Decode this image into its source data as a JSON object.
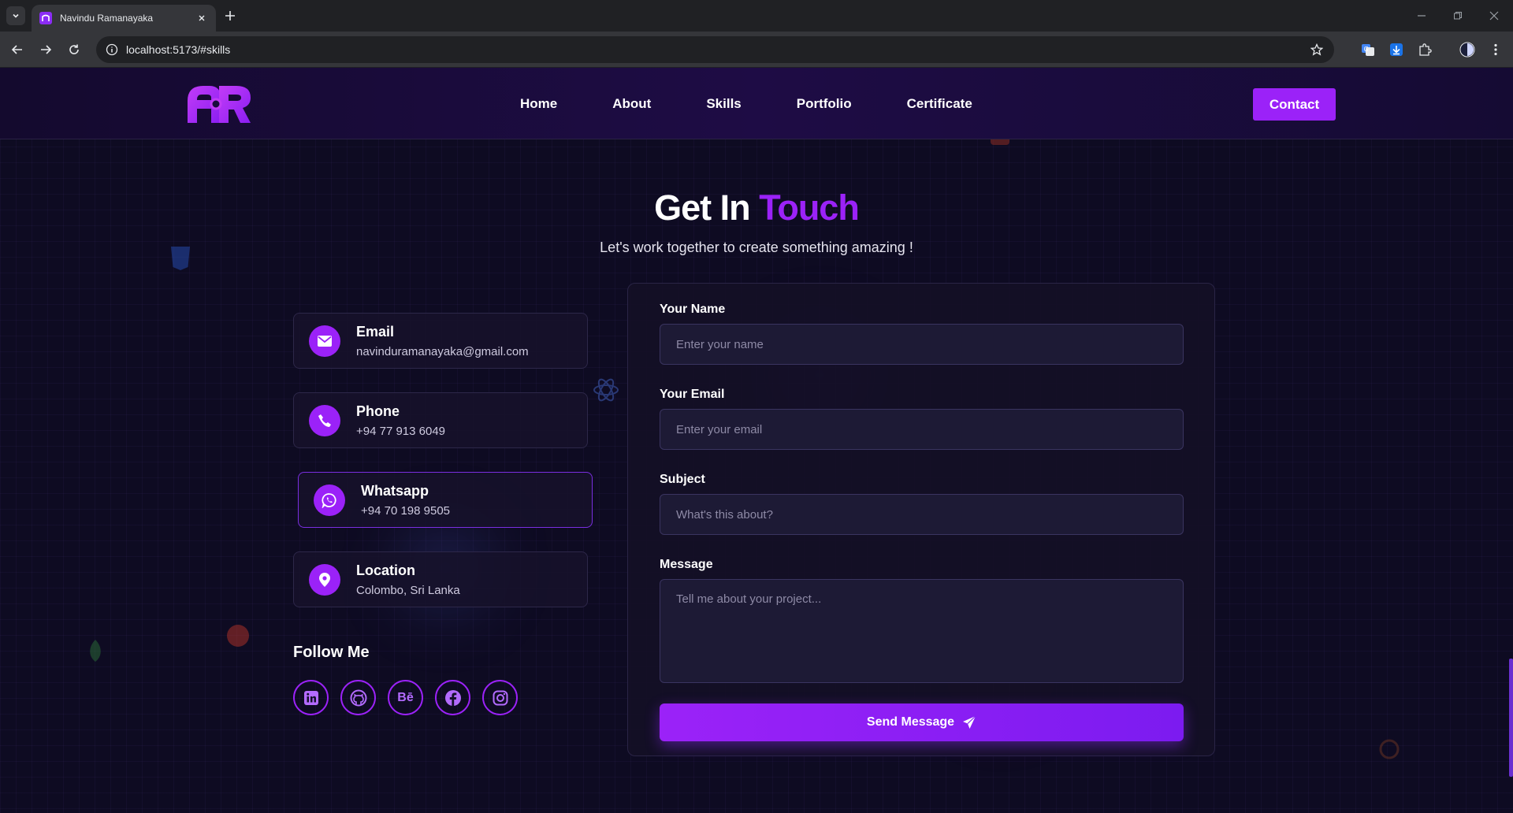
{
  "browser": {
    "tab_title": "Navindu Ramanayaka",
    "url": "localhost:5173/#skills"
  },
  "nav": {
    "links": [
      "Home",
      "About",
      "Skills",
      "Portfolio",
      "Certificate"
    ],
    "contact_label": "Contact"
  },
  "heading": {
    "prefix": "Get In",
    "accent": "Touch"
  },
  "subheading": "Let's work together to create something amazing !",
  "contact_info": [
    {
      "title": "Email",
      "value": "navinduramanayaka@gmail.com",
      "icon": "envelope-icon"
    },
    {
      "title": "Phone",
      "value": "+94 77 913 6049",
      "icon": "phone-icon"
    },
    {
      "title": "Whatsapp",
      "value": "+94 70 198 9505",
      "icon": "whatsapp-icon"
    },
    {
      "title": "Location",
      "value": "Colombo, Sri Lanka",
      "icon": "map-pin-icon"
    }
  ],
  "follow": {
    "title": "Follow Me",
    "behance_text": "Bē",
    "icons": [
      "linkedin-icon",
      "github-icon",
      "behance-icon",
      "facebook-icon",
      "instagram-icon"
    ]
  },
  "form": {
    "name_label": "Your Name",
    "name_placeholder": "Enter your name",
    "email_label": "Your Email",
    "email_placeholder": "Enter your email",
    "subject_label": "Subject",
    "subject_placeholder": "What's this about?",
    "message_label": "Message",
    "message_placeholder": "Tell me about your project...",
    "submit_label": "Send Message"
  },
  "colors": {
    "accent": "#9b22f8",
    "background": "#0e0b22",
    "card": "#16122a"
  }
}
